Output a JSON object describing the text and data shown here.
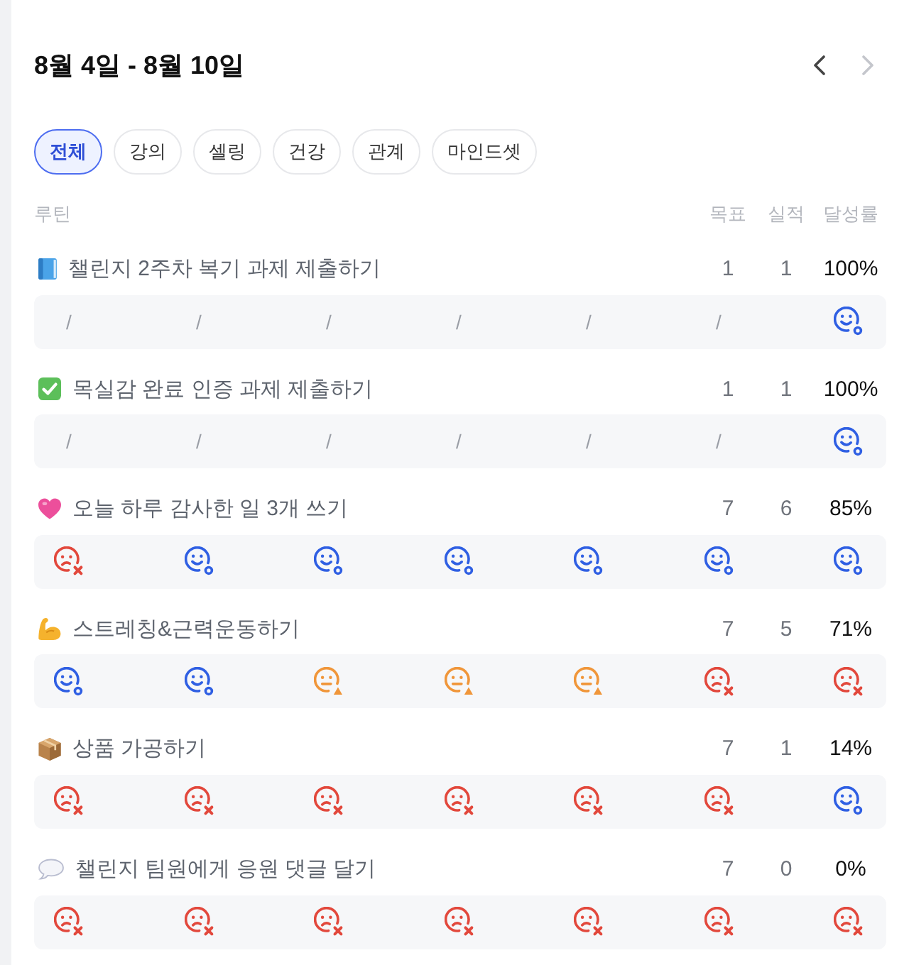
{
  "header": {
    "title": "8월 4일 - 8월 10일",
    "prev_disabled": false,
    "next_disabled": true
  },
  "chips": [
    {
      "label": "전체",
      "selected": true
    },
    {
      "label": "강의",
      "selected": false
    },
    {
      "label": "셀링",
      "selected": false
    },
    {
      "label": "건강",
      "selected": false
    },
    {
      "label": "관계",
      "selected": false
    },
    {
      "label": "마인드셋",
      "selected": false
    }
  ],
  "table": {
    "columns": [
      "루틴",
      "목표",
      "실적",
      "달성률"
    ],
    "routines": [
      {
        "kind": "book",
        "name": "챌린지 2주차 복기 과제 제출하기",
        "goal": "1",
        "actual": "1",
        "rate": "100%",
        "days": [
          {
            "kind": "empty",
            "text": "/"
          },
          {
            "kind": "empty",
            "text": "/"
          },
          {
            "kind": "empty",
            "text": "/"
          },
          {
            "kind": "empty",
            "text": "/"
          },
          {
            "kind": "empty",
            "text": "/"
          },
          {
            "kind": "empty",
            "text": "/"
          },
          {
            "kind": "done"
          }
        ]
      },
      {
        "kind": "check",
        "name": "목실감 완료 인증 과제 제출하기",
        "goal": "1",
        "actual": "1",
        "rate": "100%",
        "days": [
          {
            "kind": "empty",
            "text": "/"
          },
          {
            "kind": "empty",
            "text": "/"
          },
          {
            "kind": "empty",
            "text": "/"
          },
          {
            "kind": "empty",
            "text": "/"
          },
          {
            "kind": "empty",
            "text": "/"
          },
          {
            "kind": "empty",
            "text": "/"
          },
          {
            "kind": "done"
          }
        ]
      },
      {
        "kind": "heart",
        "name": "오늘 하루 감사한 일 3개 쓰기",
        "goal": "7",
        "actual": "6",
        "rate": "85%",
        "days": [
          {
            "kind": "missed"
          },
          {
            "kind": "done"
          },
          {
            "kind": "done"
          },
          {
            "kind": "done"
          },
          {
            "kind": "done"
          },
          {
            "kind": "done"
          },
          {
            "kind": "done"
          }
        ]
      },
      {
        "kind": "arm",
        "name": "스트레칭&근력운동하기",
        "goal": "7",
        "actual": "5",
        "rate": "71%",
        "days": [
          {
            "kind": "done"
          },
          {
            "kind": "done"
          },
          {
            "kind": "partial"
          },
          {
            "kind": "partial"
          },
          {
            "kind": "partial"
          },
          {
            "kind": "missed"
          },
          {
            "kind": "missed"
          }
        ]
      },
      {
        "kind": "package",
        "name": "상품 가공하기",
        "goal": "7",
        "actual": "1",
        "rate": "14%",
        "days": [
          {
            "kind": "missed"
          },
          {
            "kind": "missed"
          },
          {
            "kind": "missed"
          },
          {
            "kind": "missed"
          },
          {
            "kind": "missed"
          },
          {
            "kind": "missed"
          },
          {
            "kind": "done"
          }
        ]
      },
      {
        "kind": "bubble",
        "name": "챌린지 팀원에게 응원 댓글 달기",
        "goal": "7",
        "actual": "0",
        "rate": "0%",
        "days": [
          {
            "kind": "missed"
          },
          {
            "kind": "missed"
          },
          {
            "kind": "missed"
          },
          {
            "kind": "missed"
          },
          {
            "kind": "missed"
          },
          {
            "kind": "missed"
          },
          {
            "kind": "missed"
          }
        ]
      }
    ]
  }
}
